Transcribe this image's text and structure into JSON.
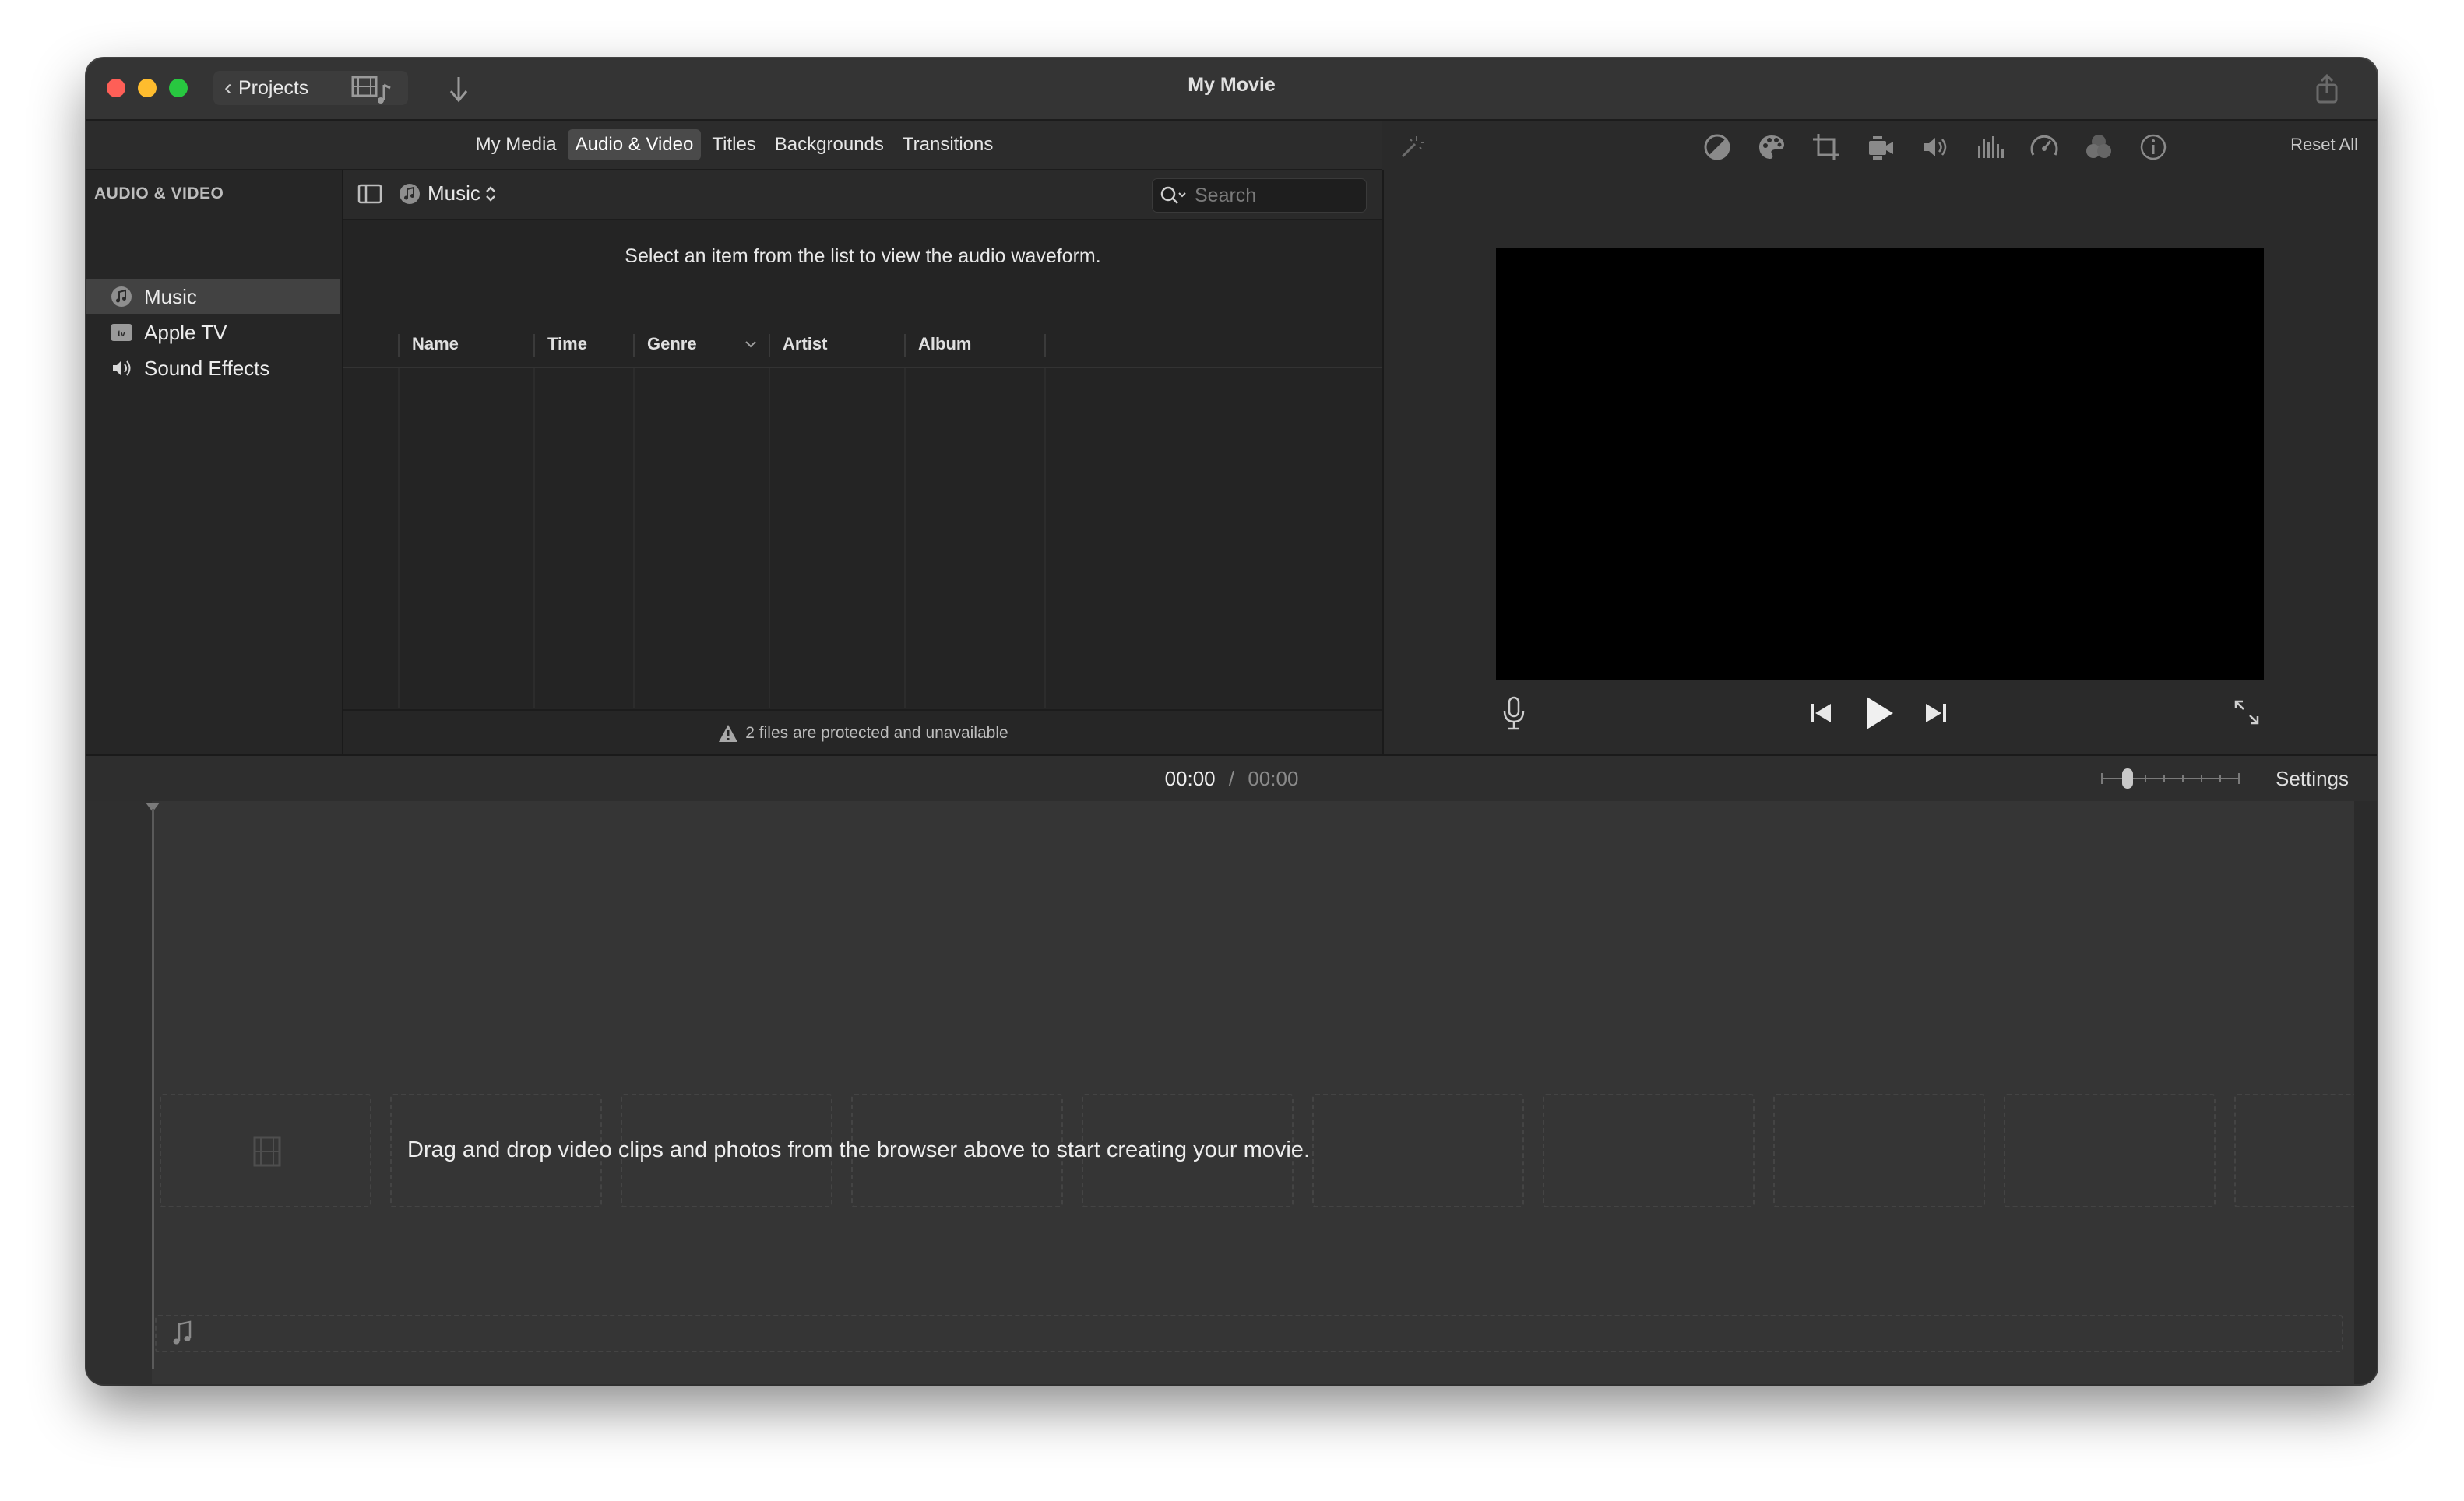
{
  "window": {
    "title": "My Movie",
    "projects_label": "Projects"
  },
  "browser": {
    "tabs": [
      {
        "label": "My Media",
        "active": false
      },
      {
        "label": "Audio & Video",
        "active": true
      },
      {
        "label": "Titles",
        "active": false
      },
      {
        "label": "Backgrounds",
        "active": false
      },
      {
        "label": "Transitions",
        "active": false
      }
    ]
  },
  "sidebar": {
    "title": "AUDIO & VIDEO",
    "items": [
      {
        "label": "Music",
        "icon": "music-icon",
        "selected": true
      },
      {
        "label": "Apple TV",
        "icon": "apple-tv-icon",
        "selected": false
      },
      {
        "label": "Sound Effects",
        "icon": "speaker-icon",
        "selected": false
      }
    ]
  },
  "content": {
    "source_select": "Music",
    "search_placeholder": "Search",
    "waveform_message": "Select an item from the list to view the audio waveform.",
    "columns": [
      "Name",
      "Time",
      "Genre",
      "Artist",
      "Album"
    ],
    "status": "2 files are protected and unavailable"
  },
  "viewer": {
    "reset_label": "Reset All",
    "tools": [
      "magic-wand-icon",
      "color-balance-icon",
      "color-correction-icon",
      "crop-icon",
      "stabilization-icon",
      "volume-icon",
      "equalizer-icon",
      "speed-icon",
      "filter-icon",
      "info-icon"
    ]
  },
  "timeline": {
    "current_time": "00:00",
    "separator": "/",
    "total_time": "00:00",
    "settings_label": "Settings",
    "drop_message": "Drag and drop video clips and photos from the browser above to start creating your movie."
  }
}
